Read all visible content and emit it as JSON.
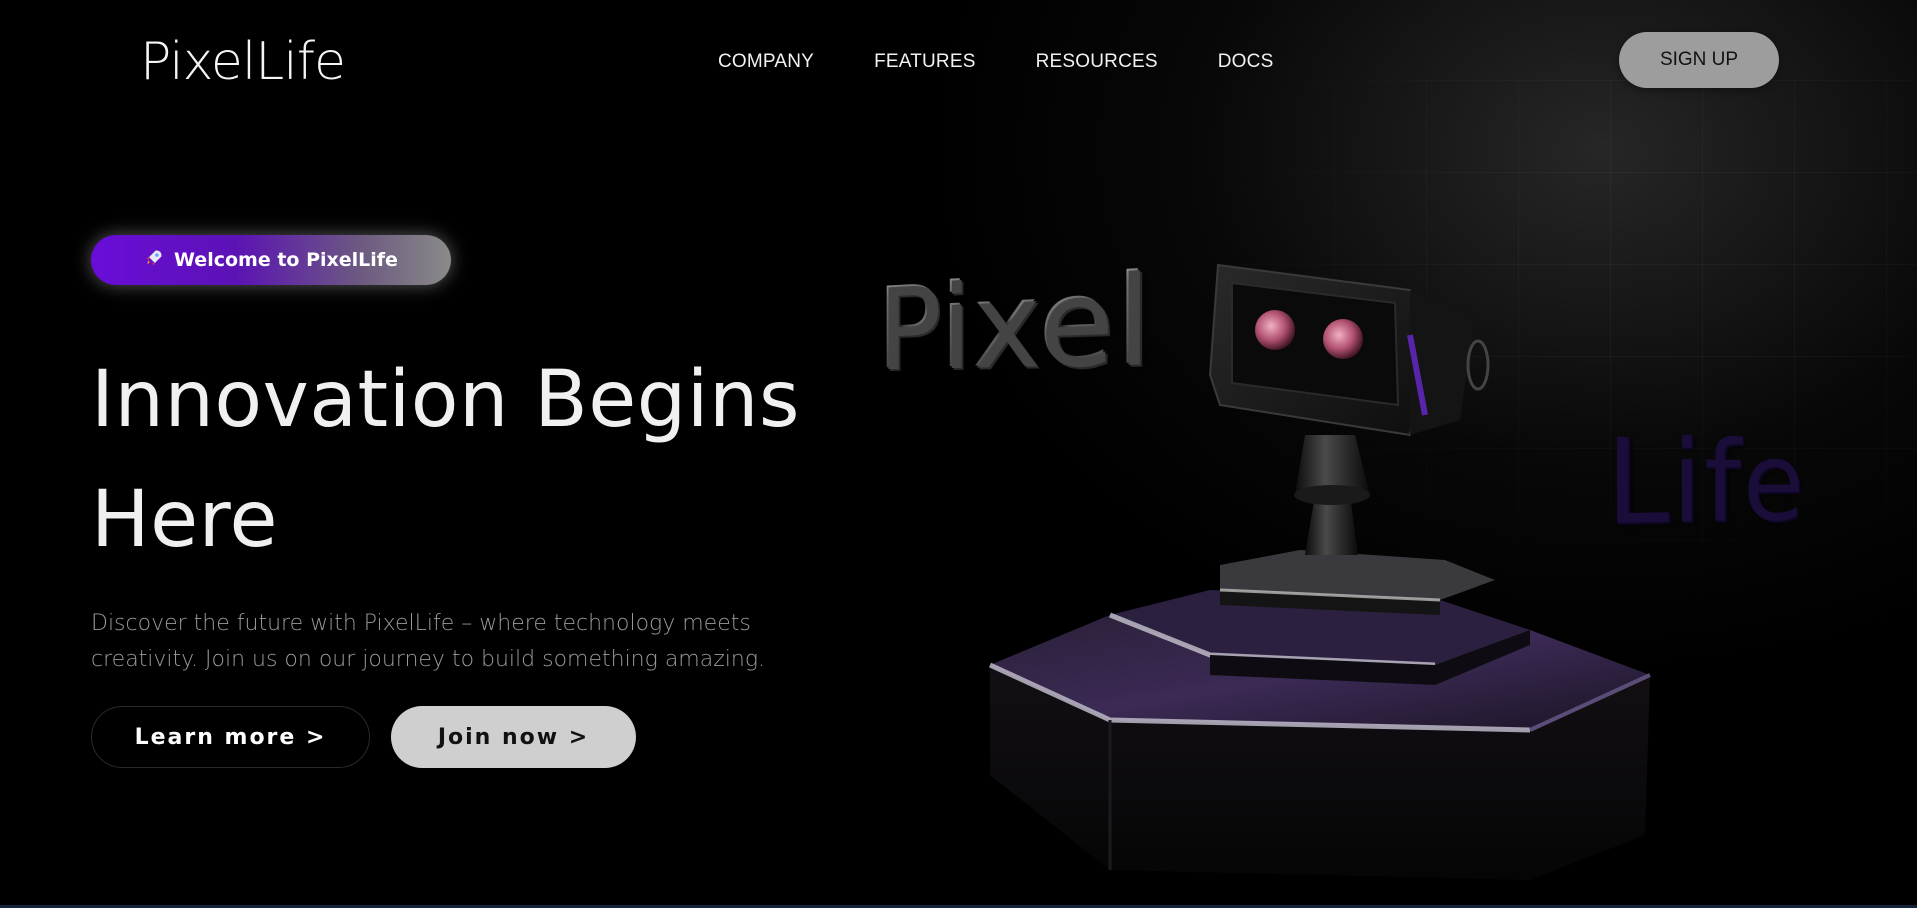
{
  "header": {
    "logo": "PixelLife",
    "nav": [
      "COMPANY",
      "FEATURES",
      "RESOURCES",
      "DOCS"
    ],
    "signup_label": "SIGN UP"
  },
  "hero": {
    "badge_icon": "rocket-icon",
    "badge_label": "Welcome to PixelLife",
    "headline_line1": "Innovation Begins",
    "headline_line2": "Here",
    "description": "Discover the future with PixelLife – where technology meets creativity. Join us on our journey to build something amazing.",
    "learn_more_label": "Learn more >",
    "join_now_label": "Join now >"
  },
  "illustration": {
    "word1": "Pixel",
    "word2": "Life"
  },
  "colors": {
    "accent_purple": "#6a0dd9",
    "signup_bg": "#9d9d9d",
    "join_bg": "#cfcfcf",
    "background": "#000000"
  }
}
